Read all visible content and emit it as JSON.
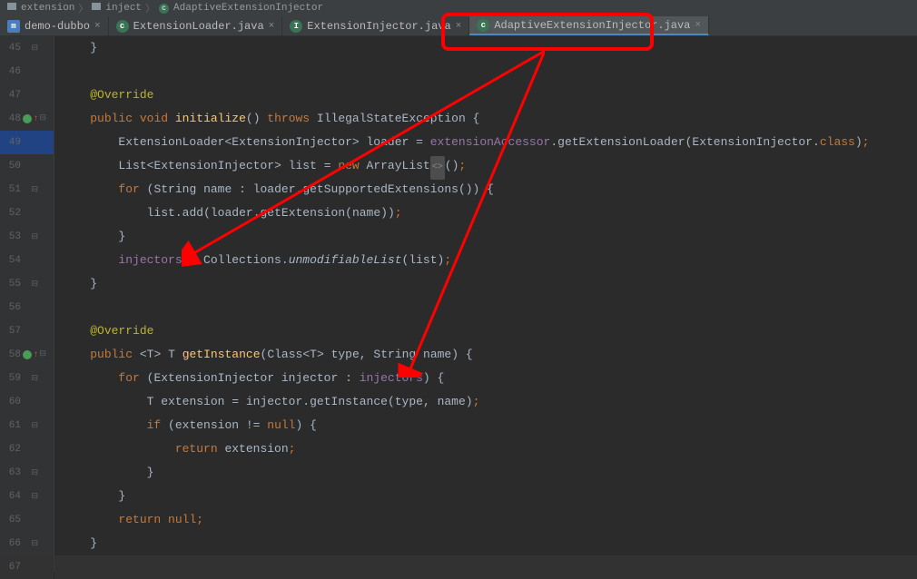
{
  "breadcrumb": {
    "parts": [
      "extension",
      "inject",
      "AdaptiveExtensionInjector"
    ]
  },
  "tabs": [
    {
      "icon": "m",
      "label": "demo-dubbo",
      "active": false
    },
    {
      "icon": "c",
      "label": "ExtensionLoader.java",
      "active": false
    },
    {
      "icon": "i",
      "label": "ExtensionInjector.java",
      "active": false
    },
    {
      "icon": "c",
      "label": "AdaptiveExtensionInjector.java",
      "active": true
    }
  ],
  "lines": {
    "start": 45,
    "end": 67
  },
  "code": {
    "override": "@Override",
    "k_public": "public",
    "k_void": "void",
    "k_throws": "throws",
    "k_new": "new",
    "k_for": "for",
    "k_if": "if",
    "k_return": "return",
    "k_null": "null",
    "k_class": "class",
    "m_initialize": "initialize",
    "m_getInstance": "getInstance",
    "t_IllegalStateException": "IllegalStateException",
    "t_ExtensionLoader": "ExtensionLoader",
    "t_ExtensionInjector": "ExtensionInjector",
    "t_List": "List",
    "t_ArrayList": "ArrayList",
    "t_String": "String",
    "t_Collections": "Collections",
    "t_Class": "Class",
    "t_T": "T",
    "v_loader": "loader",
    "v_list": "list",
    "v_name": "name",
    "v_type": "type",
    "v_injector": "injector",
    "v_extension": "extension",
    "f_extensionAccessor": "extensionAccessor",
    "f_injectors": "injectors",
    "c_getExtensionLoader": "getExtensionLoader",
    "c_getSupportedExtensions": "getSupportedExtensions",
    "c_getExtension": "getExtension",
    "c_add": "add",
    "c_unmodifiableList": "unmodifiableList",
    "diamond": "<>"
  }
}
